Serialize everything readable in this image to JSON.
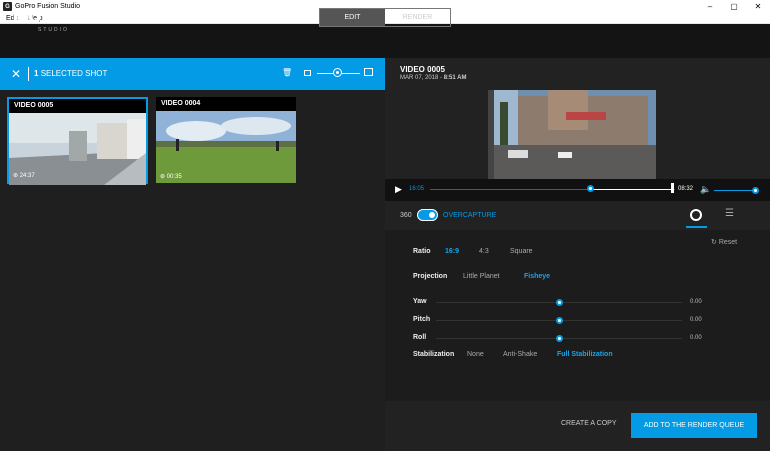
{
  "window": {
    "title": "GoPro Fusion Studio",
    "controls": [
      "–",
      "▢",
      "✕"
    ]
  },
  "menu": [
    "Edit",
    "Help"
  ],
  "app": {
    "logo": "FUSION",
    "logo_sub": "STUDIO",
    "tabs": [
      {
        "label": "EDIT",
        "active": true
      },
      {
        "label": "RENDER",
        "active": false
      }
    ]
  },
  "selection_bar": {
    "count": "1",
    "label": "SELECTED SHOT",
    "thumb_size_fraction": 0.45
  },
  "library": [
    {
      "title": "VIDEO 0005",
      "duration": "24:37",
      "selected": true
    },
    {
      "title": "VIDEO 0004",
      "duration": "00:35",
      "selected": false
    }
  ],
  "details": {
    "title": "VIDEO 0005",
    "date": "MAR 07, 2018 -",
    "time": "8:51 AM"
  },
  "player": {
    "current_time": "16:05",
    "end_time": "08:32",
    "volume_fraction": 1.0
  },
  "modes": {
    "label_360": "360",
    "label_overcapture": "OVERCAPTURE",
    "overcapture_on": true
  },
  "settings": {
    "reset_label": "Reset",
    "ratio": {
      "label": "Ratio",
      "options": [
        "16:9",
        "4:3",
        "Square"
      ],
      "selected": "16:9"
    },
    "projection": {
      "label": "Projection",
      "options": [
        "Little Planet",
        "Fisheye"
      ],
      "selected": "Fisheye"
    },
    "sliders": [
      {
        "label": "Yaw",
        "value": "0.00"
      },
      {
        "label": "Pitch",
        "value": "0.00"
      },
      {
        "label": "Roll",
        "value": "0.00"
      }
    ],
    "stabilization": {
      "label": "Stabilization",
      "options": [
        "None",
        "Anti-Shake",
        "Full Stabilization"
      ],
      "selected": "Full Stabilization"
    }
  },
  "footer": {
    "create_copy": "CREATE A COPY",
    "add_to_queue": "ADD TO THE RENDER QUEUE"
  },
  "colors": {
    "accent": "#039be5"
  }
}
